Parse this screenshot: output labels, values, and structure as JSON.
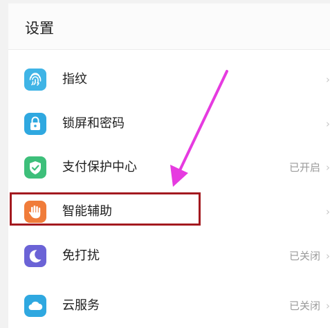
{
  "header": {
    "title": "设置"
  },
  "items": [
    {
      "label": "指纹",
      "status": "",
      "chevron": "›",
      "icon": "fingerprint-icon",
      "color": "#3fb4e6"
    },
    {
      "label": "锁屏和密码",
      "status": "",
      "chevron": "›",
      "icon": "lock-icon",
      "color": "#2fa8e0"
    },
    {
      "label": "支付保护中心",
      "status": "已开启",
      "chevron": "›",
      "icon": "shield-check-icon",
      "color": "#3dbf7a"
    },
    {
      "label": "智能辅助",
      "status": "",
      "chevron": "›",
      "icon": "hand-icon",
      "color": "#f07c3a"
    },
    {
      "label": "免打扰",
      "status": "已关闭",
      "chevron": "›",
      "icon": "moon-icon",
      "color": "#6b63d6"
    },
    {
      "label": "云服务",
      "status": "已关闭",
      "chevron": "›",
      "icon": "cloud-icon",
      "color": "#2fa8e0"
    }
  ],
  "annotation": {
    "box_color": "#a3191f",
    "arrow_color": "#e63be0"
  }
}
